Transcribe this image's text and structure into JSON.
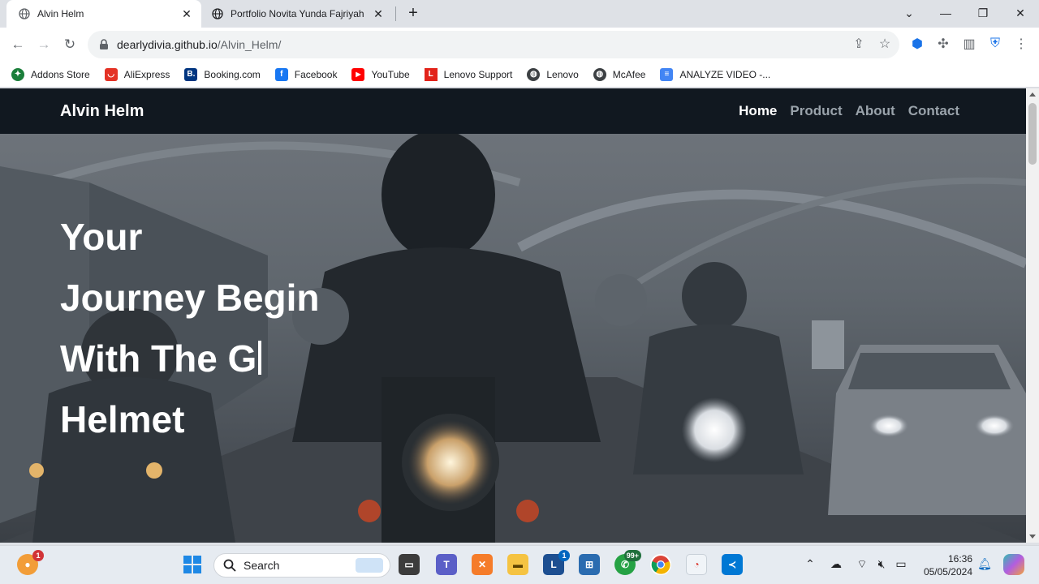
{
  "tabs": [
    {
      "title": "Alvin Helm",
      "active": true
    },
    {
      "title": "Portfolio Novita Yunda Fajriyah",
      "active": false
    }
  ],
  "address": {
    "host": "dearlydivia.github.io",
    "path": "/Alvin_Helm/"
  },
  "bookmarks": [
    {
      "label": "Addons Store",
      "color": "#1b7f3b",
      "glyph": "✦"
    },
    {
      "label": "AliExpress",
      "color": "#e43225",
      "glyph": "◡"
    },
    {
      "label": "Booking.com",
      "color": "#003580",
      "glyph": "B."
    },
    {
      "label": "Facebook",
      "color": "#1877f2",
      "glyph": "f"
    },
    {
      "label": "YouTube",
      "color": "#ff0000",
      "glyph": "▶"
    },
    {
      "label": "Lenovo Support",
      "color": "#e2231a",
      "glyph": "L"
    },
    {
      "label": "Lenovo",
      "color": "#3c4043",
      "glyph": "◍"
    },
    {
      "label": "McAfee",
      "color": "#3c4043",
      "glyph": "◍"
    },
    {
      "label": "ANALYZE VIDEO -...",
      "color": "#4285f4",
      "glyph": "≡"
    }
  ],
  "site": {
    "brand": "Alvin Helm",
    "menu": [
      "Home",
      "Product",
      "About",
      "Contact"
    ],
    "hero_lines": [
      "Your",
      "Journey Begin",
      "With The G",
      "Helmet"
    ]
  },
  "taskbar": {
    "search_label": "Search",
    "time": "16:36",
    "date": "05/05/2024",
    "badges": {
      "firefox": "1",
      "teams_l": "1",
      "whatsapp": "99+"
    }
  }
}
